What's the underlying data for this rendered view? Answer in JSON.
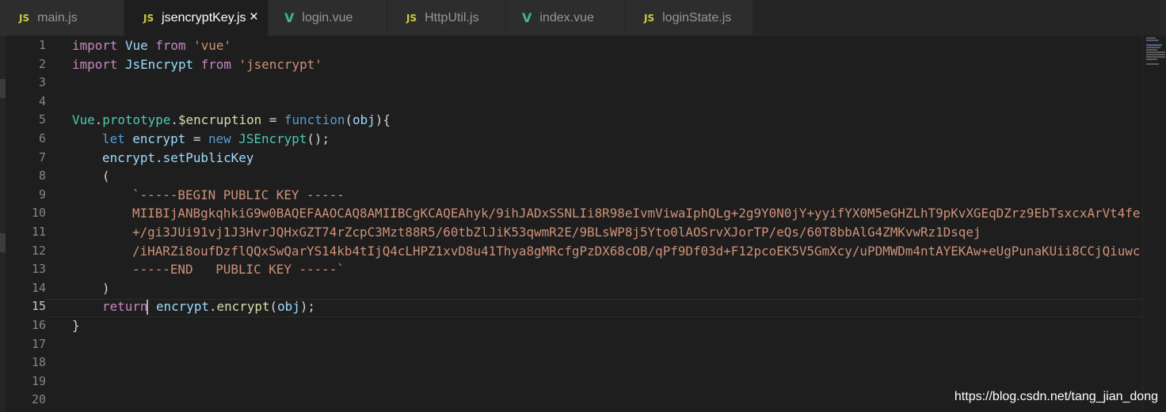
{
  "tabs": [
    {
      "label": "main.js",
      "icon": "js",
      "active": false
    },
    {
      "label": "jsencryptKey.js",
      "icon": "js",
      "active": true
    },
    {
      "label": "login.vue",
      "icon": "vue",
      "active": false
    },
    {
      "label": "HttpUtil.js",
      "icon": "js",
      "active": false
    },
    {
      "label": "index.vue",
      "icon": "vue",
      "active": false
    },
    {
      "label": "loginState.js",
      "icon": "js",
      "active": false
    }
  ],
  "icon_labels": {
    "js": "JS",
    "vue": "V",
    "close": "×"
  },
  "line_numbers": [
    "1",
    "2",
    "3",
    "4",
    "5",
    "6",
    "7",
    "8",
    "9",
    "10",
    "11",
    "12",
    "13",
    "14",
    "15",
    "16",
    "17",
    "18",
    "19",
    "20"
  ],
  "code": {
    "l1": {
      "kw": "import",
      "name": "Vue",
      "from": "from",
      "str": "'vue'"
    },
    "l2": {
      "kw": "import",
      "name": "JsEncrypt",
      "from": "from",
      "str": "'jsencrypt'"
    },
    "l5": {
      "obj": "Vue",
      "dot1": ".",
      "proto": "prototype",
      "dot2": ".",
      "method": "$encruption",
      "eq": " = ",
      "fnkw": "function",
      "open": "(",
      "param": "obj",
      "close": "){"
    },
    "l6": {
      "let": "let",
      "var": "encrypt",
      "eq": " = ",
      "new": "new",
      "cls": "JSEncrypt",
      "tail": "();"
    },
    "l7": {
      "var": "encrypt",
      "dot": ".",
      "fn": "setPublicKey"
    },
    "l8": "(",
    "l9": "`-----BEGIN PUBLIC KEY -----",
    "l10": "MIIBIjANBgkqhkiG9w0BAQEFAAOCAQ8AMIIBCgKCAQEAhyk/9ihJADxSSNLIi8R98eIvmViwaIphQLg+2g9Y0N0jY+yyifYX0M5eGHZLhT9pKvXGEqDZrz9EbTsxcxArVt4fe",
    "l11": "+/gi3JUi91vj1J3HvrJQHxGZT74rZcpC3Mzt88R5/60tbZlJiK53qwmR2E/9BLsWP8j5Yto0lAOSrvXJorTP/eQs/60T8bbAlG4ZMKvwRz1Dsqej",
    "l12": "/iHARZi8oufDzflQQxSwQarYS14kb4tIjQ4cLHPZ1xvD8u41Thya8gMRcfgPzDX68cOB/qPf9Df03d+F12pcoEK5V5GmXcy/uPDMWDm4ntAYEKAw+eUgPunaKUii8CCjQiuwc",
    "l13": "-----END   PUBLIC KEY -----`",
    "l14": ")",
    "l15": {
      "ret": "return",
      "var": "encrypt",
      "dot": ".",
      "fn": "encrypt",
      "open": "(",
      "param": "obj",
      "close": ");"
    },
    "l16": "}"
  },
  "watermark": "https://blog.csdn.net/tang_jian_dong",
  "colors": {
    "keyword": "#c586c0",
    "storage": "#569cd6",
    "class": "#4ec9b0",
    "function": "#dcdcaa",
    "variable": "#9cdcfe",
    "string": "#ce9178",
    "background": "#1e1e1e"
  }
}
